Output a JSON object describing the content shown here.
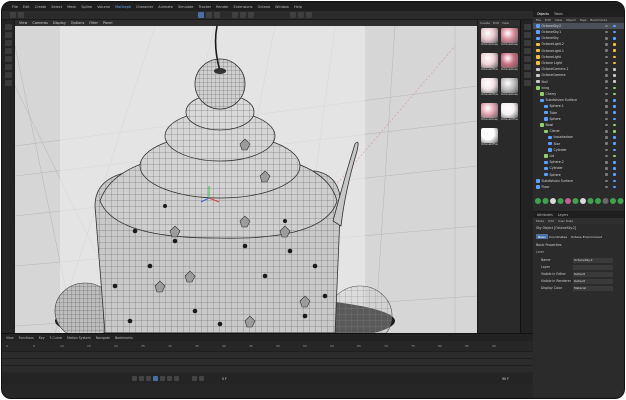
{
  "menubar": {
    "items": [
      "File",
      "Edit",
      "Create",
      "Select",
      "Mesh",
      "Spline",
      "Volume",
      "MoGraph",
      "Character",
      "Animate",
      "Simulate",
      "Tracker",
      "Render",
      "Extensions",
      "Octane",
      "Window",
      "Help"
    ],
    "active_index": 7
  },
  "viewport": {
    "menu": [
      "View",
      "Cameras",
      "Display",
      "Options",
      "Filter",
      "Panel"
    ],
    "background_color": "#d6d6d6"
  },
  "materials": {
    "header": [
      "Create",
      "Edit",
      "View",
      "Select",
      "Material",
      "Texture"
    ],
    "items": [
      {
        "label": "OctaneGlossy",
        "color": "#e8c7ce"
      },
      {
        "label": "OctaneGlossy",
        "color": "#d98a9a"
      },
      {
        "label": "OctaneDiffuse",
        "color": "#f0d2d6"
      },
      {
        "label": "OctaneGlossy",
        "color": "#c86d80"
      },
      {
        "label": "OctaneDiffuse",
        "color": "#f3e4e6"
      },
      {
        "label": "OctaneGlossy",
        "color": "#bfbfbf"
      },
      {
        "label": "OctaneGlossy",
        "color": "#e2a4b0"
      },
      {
        "label": "OctaneDiffuse",
        "color": "#f6f1f2"
      },
      {
        "label": "OctaneDiffuse",
        "color": "#ffffff"
      }
    ]
  },
  "objects_panel": {
    "tabs": [
      "Objects",
      "Takes"
    ],
    "menu": [
      "File",
      "Edit",
      "View",
      "Object",
      "Tags",
      "Bookmarks"
    ],
    "rows": [
      {
        "label": "OctaneSky.2",
        "color": "#5aa0ff",
        "indent": 0,
        "selected": true
      },
      {
        "label": "OctaneSky.1",
        "color": "#5aa0ff",
        "indent": 0
      },
      {
        "label": "OctaneSky",
        "color": "#5aa0ff",
        "indent": 0
      },
      {
        "label": "OctaneLight.2",
        "color": "#f0c040",
        "indent": 0
      },
      {
        "label": "OctaneLight.1",
        "color": "#f0c040",
        "indent": 0
      },
      {
        "label": "OctaneLight",
        "color": "#f0c040",
        "indent": 0
      },
      {
        "label": "Octane Light",
        "color": "#f0c040",
        "indent": 0
      },
      {
        "label": "OctaneCamera.1",
        "color": "#c8c8c8",
        "indent": 0
      },
      {
        "label": "OctaneCamera",
        "color": "#c8c8c8",
        "indent": 0
      },
      {
        "label": "Null",
        "color": "#c8c8c8",
        "indent": 0
      },
      {
        "label": "Icing",
        "color": "#8fd16f",
        "indent": 0
      },
      {
        "label": "Cherry",
        "color": "#8fd16f",
        "indent": 1
      },
      {
        "label": "Subdivision Surface",
        "color": "#5aa0ff",
        "indent": 1
      },
      {
        "label": "Sphere.1",
        "color": "#5aa0ff",
        "indent": 2
      },
      {
        "label": "Tube",
        "color": "#5aa0ff",
        "indent": 2
      },
      {
        "label": "Sphere",
        "color": "#5aa0ff",
        "indent": 2
      },
      {
        "label": "Bowl",
        "color": "#8fd16f",
        "indent": 1
      },
      {
        "label": "Cloner",
        "color": "#8fd16f",
        "indent": 2
      },
      {
        "label": "Icosahedron",
        "color": "#5aa0ff",
        "indent": 3
      },
      {
        "label": "Star",
        "color": "#5aa0ff",
        "indent": 3
      },
      {
        "label": "Cylinder",
        "color": "#5aa0ff",
        "indent": 3
      },
      {
        "label": "Lid",
        "color": "#8fd16f",
        "indent": 2
      },
      {
        "label": "Sphere.2",
        "color": "#5aa0ff",
        "indent": 2
      },
      {
        "label": "Cylinder",
        "color": "#5aa0ff",
        "indent": 2
      },
      {
        "label": "Sphere",
        "color": "#5aa0ff",
        "indent": 2
      },
      {
        "label": "Subdivision Surface",
        "color": "#5aa0ff",
        "indent": 0
      },
      {
        "label": "Floor",
        "color": "#5aa0ff",
        "indent": 0
      }
    ]
  },
  "attributes": {
    "tabs": [
      "Attributes",
      "Layers"
    ],
    "menu": [
      "Mode",
      "Edit",
      "User Data"
    ],
    "object_title": "Sky Object [OctaneSky.2]",
    "section_tabs": [
      "Basic",
      "Coordinates",
      "Octane Environment"
    ],
    "section_title": "Basic Properties",
    "subsection": "Lerer",
    "fields": [
      {
        "label": "Name",
        "value": "OctaneSky.2"
      },
      {
        "label": "Layer",
        "value": ""
      },
      {
        "label": "Visible in Editor",
        "value": "Default"
      },
      {
        "label": "Visible in Renderer",
        "value": "Default"
      },
      {
        "label": "Display Color",
        "value": "Material"
      }
    ]
  },
  "timeline": {
    "menu": [
      "View",
      "Functions",
      "Key",
      "F-Curve",
      "Motion System",
      "Navigate",
      "Bookmarks"
    ],
    "ruler": [
      "0",
      "5",
      "10",
      "15",
      "20",
      "25",
      "30",
      "35",
      "40",
      "45",
      "50",
      "55",
      "60",
      "65",
      "70",
      "75",
      "80",
      "85",
      "90"
    ],
    "current_frame": "0 F",
    "end_frame": "90 F"
  }
}
